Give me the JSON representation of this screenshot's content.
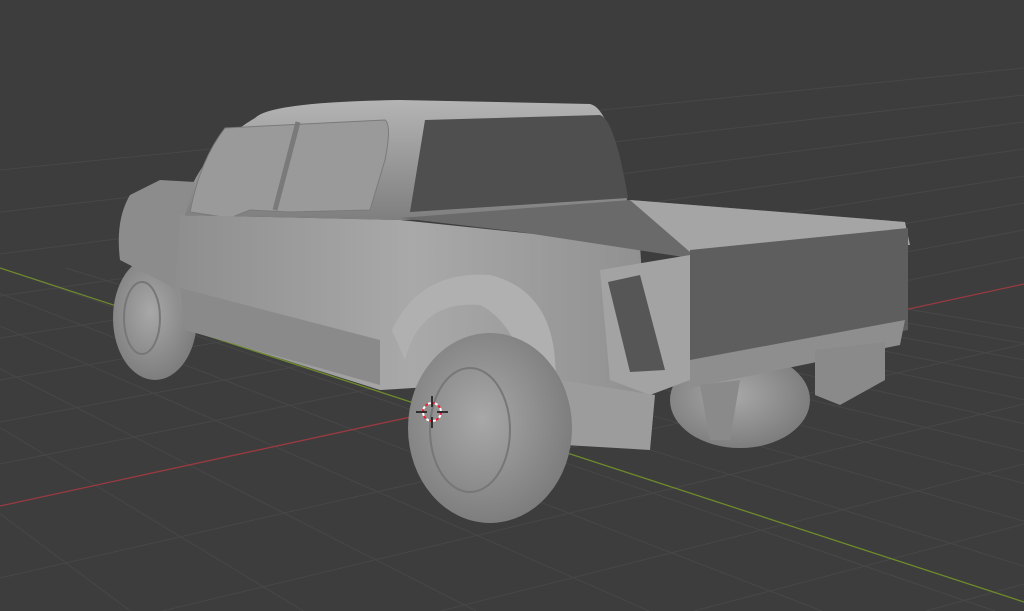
{
  "viewport": {
    "background": "#3d3d3d",
    "grid_color": "#474747",
    "x_axis_color": "#9a3a40",
    "y_axis_color": "#6e8a2c",
    "model_color": "#9c9c9c"
  },
  "cursor_3d": {
    "visible": true
  }
}
